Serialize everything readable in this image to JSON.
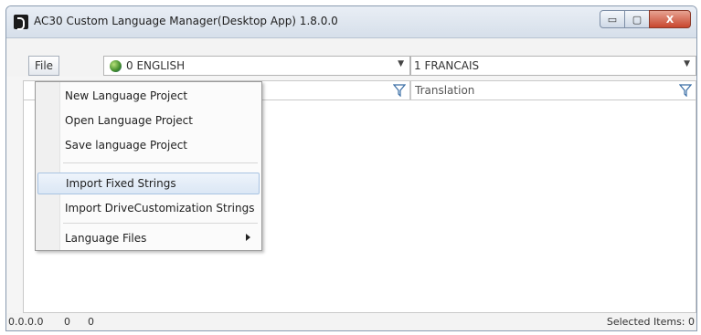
{
  "window": {
    "title": "AC30 Custom Language Manager(Desktop App)  1.8.0.0",
    "buttons": {
      "minimize": "▭",
      "maximize": "▢",
      "close": "X"
    }
  },
  "toolbar": {
    "file_label": "File",
    "source_language": "0 ENGLISH",
    "target_language": "1 FRANCAIS"
  },
  "grid": {
    "columns": [
      "",
      "Translation"
    ]
  },
  "file_menu": {
    "items": [
      {
        "label": "New Language Project"
      },
      {
        "label": "Open Language Project"
      },
      {
        "label": "Save language Project"
      },
      {
        "label": "Import Fixed Strings"
      },
      {
        "label": "Import DriveCustomization Strings"
      },
      {
        "label": "Language Files"
      }
    ],
    "hovered": "Import Fixed Strings"
  },
  "status": {
    "version": "0.0.0.0",
    "count_a": "0",
    "count_b": "0",
    "selected_items": "Selected Items: 0"
  }
}
